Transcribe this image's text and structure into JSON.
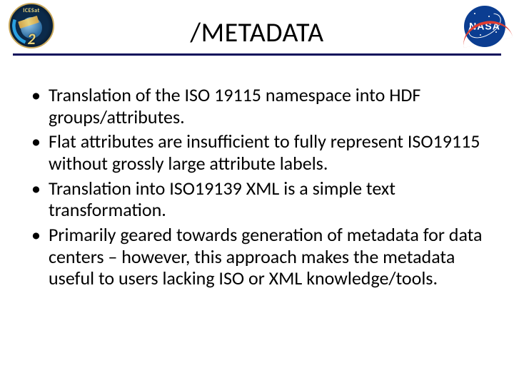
{
  "header": {
    "title": "/METADATA",
    "left_logo": {
      "name": "ICESat",
      "number": "2"
    },
    "right_logo": {
      "name": "NASA"
    }
  },
  "bullets": [
    "Translation of the ISO 19115 namespace into HDF groups/attributes.",
    "Flat attributes are insufficient to fully represent ISO19115 without grossly large attribute labels.",
    "Translation into ISO19139 XML is a simple text transformation.",
    "Primarily geared towards generation of metadata for data centers – however, this approach makes the metadata useful to users lacking ISO or XML knowledge/tools."
  ]
}
